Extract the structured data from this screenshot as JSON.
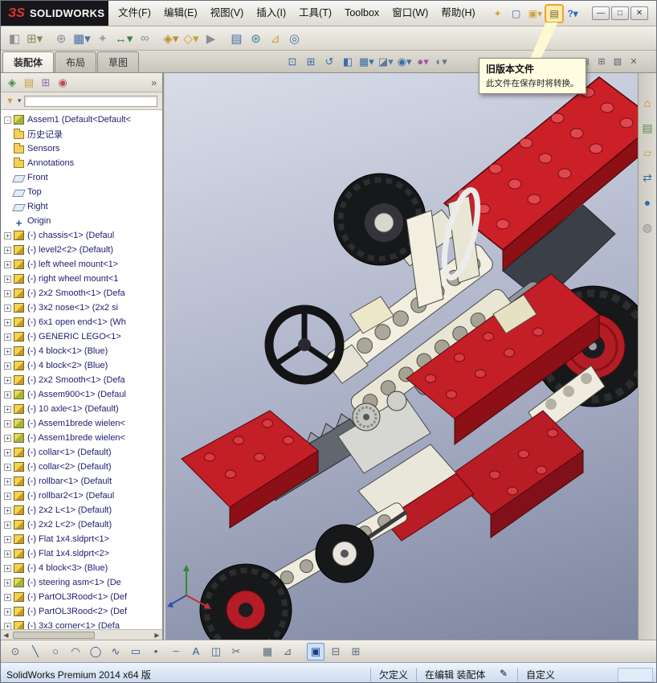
{
  "titlebar": {
    "logo": {
      "mark": "ЗS",
      "text": "SOLIDWORKS"
    },
    "menus": [
      "文件(F)",
      "编辑(E)",
      "视图(V)",
      "插入(I)",
      "工具(T)",
      "Toolbox",
      "窗口(W)",
      "帮助(H)"
    ],
    "quick": [
      {
        "name": "menu-pin-icon",
        "glyph": "✦",
        "style": "color:#caa43c"
      },
      {
        "name": "new-document-icon",
        "glyph": "▢",
        "style": "color:#3a6ea5"
      },
      {
        "name": "open-document-icon",
        "glyph": "▣▾",
        "style": "color:#caa43c"
      },
      {
        "name": "old-version-file-warning-icon",
        "glyph": "▤",
        "style": "color:#6a5a2a;background:#ffeeb0;outline:2px solid #f0a030"
      },
      {
        "name": "help-search-icon",
        "glyph": "?▾",
        "style": "color:#2a6fb8;font-weight:bold"
      }
    ],
    "window_buttons": [
      {
        "name": "minimize-button",
        "glyph": "—"
      },
      {
        "name": "maximize-button",
        "glyph": "□"
      },
      {
        "name": "close-button",
        "glyph": "✕"
      }
    ]
  },
  "toolbar": {
    "items": [
      {
        "name": "edit-component-icon",
        "glyph": "◧",
        "style": "color:#8a8f96"
      },
      {
        "name": "insert-components-icon",
        "glyph": "⊞▾",
        "style": "color:#7a8f5a"
      },
      {
        "name": "mate-icon",
        "glyph": "⊕",
        "style": "color:#8a8f96;margin-left:8px"
      },
      {
        "name": "linear-component-pattern-icon",
        "glyph": "▦▾",
        "style": "color:#4a6fa5"
      },
      {
        "name": "smart-fasteners-icon",
        "glyph": "✦",
        "style": "color:#9aa0a8"
      },
      {
        "name": "move-component-icon",
        "glyph": "↔▾",
        "style": "color:#3f7f4f"
      },
      {
        "name": "show-hidden-components-icon",
        "glyph": "∞",
        "style": "color:#8a8f96"
      },
      {
        "name": "assembly-features-icon",
        "glyph": "◈▾",
        "style": "color:#b8912f;margin-left:8px"
      },
      {
        "name": "reference-geometry-icon",
        "glyph": "◇▾",
        "style": "color:#c9a23a"
      },
      {
        "name": "new-motion-study-icon",
        "glyph": "▶",
        "style": "color:#8a8f96"
      },
      {
        "name": "bill-of-materials-icon",
        "glyph": "▤",
        "style": "color:#4a6fa5;margin-left:8px"
      },
      {
        "name": "exploded-view-icon",
        "glyph": "⊛",
        "style": "color:#3f7f9f"
      },
      {
        "name": "instant3d-icon",
        "glyph": "⊿",
        "style": "color:#caa43c"
      },
      {
        "name": "large-design-review-icon",
        "glyph": "◎",
        "style": "color:#4a6fa5"
      }
    ]
  },
  "tabstrip": {
    "tabs": [
      {
        "name": "tab-assembly",
        "label": "装配体",
        "active": true
      },
      {
        "name": "tab-layout",
        "label": "布局",
        "active": false
      },
      {
        "name": "tab-sketch",
        "label": "草图",
        "active": false
      }
    ],
    "view_tools": [
      {
        "name": "zoom-fit-icon",
        "glyph": "⊡",
        "style": "color:#3a6ea5"
      },
      {
        "name": "zoom-area-icon",
        "glyph": "⊞",
        "style": "color:#3a6ea5"
      },
      {
        "name": "previous-view-icon",
        "glyph": "↺",
        "style": "color:#3a6ea5"
      },
      {
        "name": "section-view-icon",
        "glyph": "◧",
        "style": "color:#3a6ea5"
      },
      {
        "name": "view-orientation-icon",
        "glyph": "▦▾",
        "style": "color:#3a6ea5"
      },
      {
        "name": "display-style-icon",
        "glyph": "◪▾",
        "style": "color:#5a7a9a"
      },
      {
        "name": "hide-show-items-icon",
        "glyph": "◉▾",
        "style": "color:#3a6ea5"
      },
      {
        "name": "edit-appearance-icon",
        "glyph": "●▾",
        "style": "color:#a05a9a"
      },
      {
        "name": "apply-scene-icon",
        "glyph": "◐▾",
        "style": "color:#6a7a8a"
      }
    ],
    "pane_tools": [
      {
        "name": "featuremanager-pane-toggle-icon",
        "glyph": "◨"
      },
      {
        "name": "pane-split-horizontal-icon",
        "glyph": "⊟"
      },
      {
        "name": "pane-split-vertical-icon",
        "glyph": "⊞"
      },
      {
        "name": "pane-float-icon",
        "glyph": "▧"
      },
      {
        "name": "close-pane-icon",
        "glyph": "✕"
      }
    ]
  },
  "tooltip": {
    "title": "旧版本文件",
    "body": "此文件在保存时将转换。"
  },
  "left_panel": {
    "tabs": [
      {
        "name": "featuremanager-tab-icon",
        "glyph": "◈",
        "style": "color:#3f8f3f"
      },
      {
        "name": "propertymanager-tab-icon",
        "glyph": "▤",
        "style": "color:#c9a23a"
      },
      {
        "name": "configurationmanager-tab-icon",
        "glyph": "⊞",
        "style": "color:#8a6fb0"
      },
      {
        "name": "displaymanager-tab-icon",
        "glyph": "◉",
        "style": "color:#c04a4a"
      }
    ],
    "overflow_glyph": "»",
    "filter_glyph": "▼",
    "filter_chevron": "▾",
    "hscroll_left": "◀",
    "hscroll_right": "▶",
    "tree": [
      {
        "exp": "-",
        "icon": "assembly-root",
        "label": "Assem1 (Default<Default<"
      },
      {
        "exp": "",
        "icon": "folder",
        "label": "历史记录"
      },
      {
        "exp": "",
        "icon": "folder",
        "label": "Sensors"
      },
      {
        "exp": "",
        "icon": "folder",
        "label": "Annotations"
      },
      {
        "exp": "",
        "icon": "plane",
        "label": "Front"
      },
      {
        "exp": "",
        "icon": "plane",
        "label": "Top"
      },
      {
        "exp": "",
        "icon": "plane",
        "label": "Right"
      },
      {
        "exp": "",
        "icon": "origin",
        "label": "Origin"
      },
      {
        "exp": "+",
        "icon": "part",
        "label": "(-) chassis<1> (Defaul"
      },
      {
        "exp": "+",
        "icon": "part",
        "label": "(-) level2<2> (Default)"
      },
      {
        "exp": "+",
        "icon": "part",
        "label": "(-) left wheel mount<1>"
      },
      {
        "exp": "+",
        "icon": "part",
        "label": "(-) right wheel mount<1"
      },
      {
        "exp": "+",
        "icon": "part",
        "label": "(-) 2x2 Smooth<1> (Defa"
      },
      {
        "exp": "+",
        "icon": "part",
        "label": "(-) 3x2 nose<1> (2x2 si"
      },
      {
        "exp": "+",
        "icon": "part",
        "label": "(-) 6x1 open end<1> (Wh"
      },
      {
        "exp": "+",
        "icon": "part",
        "label": "(-) GENERIC LEGO<1>"
      },
      {
        "exp": "+",
        "icon": "part",
        "label": "(-) 4 block<1> (Blue)"
      },
      {
        "exp": "+",
        "icon": "part",
        "label": "(-) 4 block<2> (Blue)"
      },
      {
        "exp": "+",
        "icon": "part",
        "label": "(-) 2x2 Smooth<1> (Defa"
      },
      {
        "exp": "+",
        "icon": "assembly",
        "label": "(-) Assem900<1> (Defaul"
      },
      {
        "exp": "+",
        "icon": "part",
        "label": "(-) 10 axle<1> (Default)"
      },
      {
        "exp": "+",
        "icon": "assembly",
        "label": "(-) Assem1brede wielen<"
      },
      {
        "exp": "+",
        "icon": "assembly",
        "label": "(-) Assem1brede wielen<"
      },
      {
        "exp": "+",
        "icon": "part",
        "label": "(-) collar<1> (Default)"
      },
      {
        "exp": "+",
        "icon": "part",
        "label": "(-) collar<2> (Default)"
      },
      {
        "exp": "+",
        "icon": "part",
        "label": "(-) rollbar<1> (Default"
      },
      {
        "exp": "+",
        "icon": "part",
        "label": "(-) rollbar2<1> (Defaul"
      },
      {
        "exp": "+",
        "icon": "part",
        "label": "(-) 2x2 L<1> (Default)"
      },
      {
        "exp": "+",
        "icon": "part",
        "label": "(-) 2x2 L<2> (Default)"
      },
      {
        "exp": "+",
        "icon": "part",
        "label": "(-) Flat 1x4.sldprt<1>"
      },
      {
        "exp": "+",
        "icon": "part",
        "label": "(-) Flat 1x4.sldprt<2>"
      },
      {
        "exp": "+",
        "icon": "part",
        "label": "(-) 4 block<3> (Blue)"
      },
      {
        "exp": "+",
        "icon": "assembly",
        "label": "(-) steering asm<1> (De"
      },
      {
        "exp": "+",
        "icon": "part",
        "label": "(-) PartOL3Rood<1> (Def"
      },
      {
        "exp": "+",
        "icon": "part",
        "label": "(-) PartOL3Rood<2> (Def"
      },
      {
        "exp": "+",
        "icon": "part",
        "label": "(-) 3x3 corner<1> (Defa"
      }
    ]
  },
  "taskpane": {
    "items": [
      {
        "name": "home-icon",
        "glyph": "⌂",
        "style": "color:#c96a2a"
      },
      {
        "name": "design-library-icon",
        "glyph": "▤",
        "style": "color:#5a8a4a"
      },
      {
        "name": "file-explorer-icon",
        "glyph": "▱",
        "style": "color:#c9a23a"
      },
      {
        "name": "view-palette-icon",
        "glyph": "⇄",
        "style": "color:#3a6ea5"
      },
      {
        "name": "appearances-icon",
        "glyph": "●",
        "style": "color:#2a6fb8"
      },
      {
        "name": "custom-properties-icon",
        "glyph": "◍",
        "style": "color:#8a8f96"
      }
    ]
  },
  "sketch_toolbar": {
    "items": [
      {
        "name": "select-icon",
        "glyph": "⊙",
        "style": "color:#5a6a7a"
      },
      {
        "name": "line-icon",
        "glyph": "╲",
        "style": "color:#3a5a8c"
      },
      {
        "name": "circle-icon",
        "glyph": "○",
        "style": "color:#3a5a8c"
      },
      {
        "name": "arc-icon",
        "glyph": "◠",
        "style": "color:#3a5a8c"
      },
      {
        "name": "ellipse-icon",
        "glyph": "◯",
        "style": "color:#3a5a8c"
      },
      {
        "name": "spline-icon",
        "glyph": "∿",
        "style": "color:#3a5a8c"
      },
      {
        "name": "rectangle-icon",
        "glyph": "▭",
        "style": "color:#3a5a8c"
      },
      {
        "name": "point-icon",
        "glyph": "•",
        "style": "color:#3a5a8c"
      },
      {
        "name": "centerline-icon",
        "glyph": "┄",
        "style": "color:#3a5a8c"
      },
      {
        "name": "text-sketch-icon",
        "glyph": "A",
        "style": "color:#3a5a8c"
      },
      {
        "name": "mirror-entities-icon",
        "glyph": "◫",
        "style": "color:#3a5a8c"
      },
      {
        "name": "trim-entities-icon",
        "glyph": "✂",
        "style": "color:#5a6a7a"
      },
      {
        "name": "grid-snap-icon",
        "glyph": "▦",
        "style": "color:#5a6a7a;margin-left:14px"
      },
      {
        "name": "quick-snaps-icon",
        "glyph": "⊿",
        "style": "color:#5a6a7a"
      },
      {
        "name": "single-view-icon",
        "glyph": "▣",
        "style": "color:#1a3a8c;background:#cfe0f5;border:1px solid #6a9ad0;margin-left:10px"
      },
      {
        "name": "two-view-icon",
        "glyph": "⊟",
        "style": "color:#5a6a7a"
      },
      {
        "name": "four-view-icon",
        "glyph": "⊞",
        "style": "color:#5a6a7a"
      }
    ]
  },
  "statusbar": {
    "product": "SolidWorks Premium 2014 x64 版",
    "definition_status": "欠定义",
    "editing_status": "在编辑 装配体",
    "edit_icon_glyph": "✎",
    "custom_label": "自定义"
  },
  "accent_colors": {
    "lego_red": "#c41e26",
    "hub_red": "#b41d26",
    "tooltip_bg": "#fffde1",
    "highlight_orange": "#f0a030"
  }
}
